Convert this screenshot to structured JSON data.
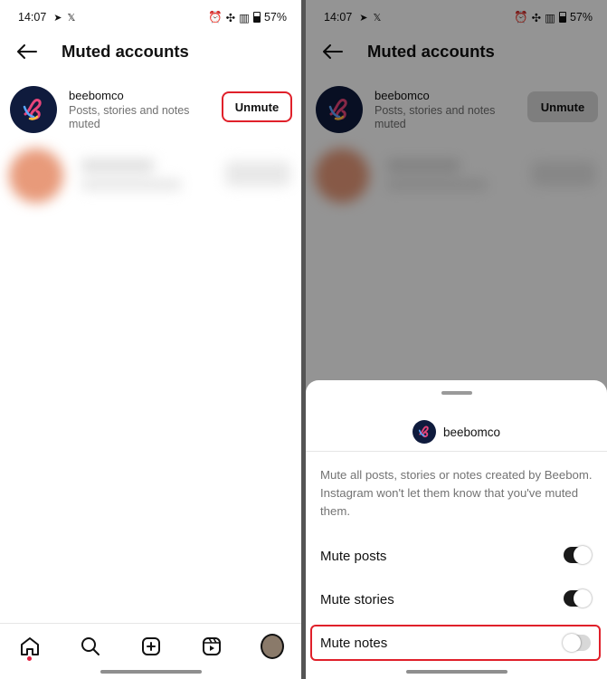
{
  "status_bar": {
    "time": "14:07",
    "battery": "57%"
  },
  "header": {
    "title": "Muted accounts"
  },
  "account": {
    "name": "beebomco",
    "description": "Posts, stories and notes muted",
    "unmute_label": "Unmute"
  },
  "sheet": {
    "name": "beebomco",
    "description": "Mute all posts, stories or notes created by Beebom. Instagram won't let them know that you've muted them.",
    "options": [
      {
        "label": "Mute posts",
        "on": true
      },
      {
        "label": "Mute stories",
        "on": true
      },
      {
        "label": "Mute notes",
        "on": false
      }
    ]
  },
  "bottom_nav": [
    "home-icon",
    "search-icon",
    "create-icon",
    "reels-icon",
    "profile-avatar"
  ],
  "colors": {
    "highlight": "#e0202a",
    "avatar_bg": "#0f1b3d"
  }
}
